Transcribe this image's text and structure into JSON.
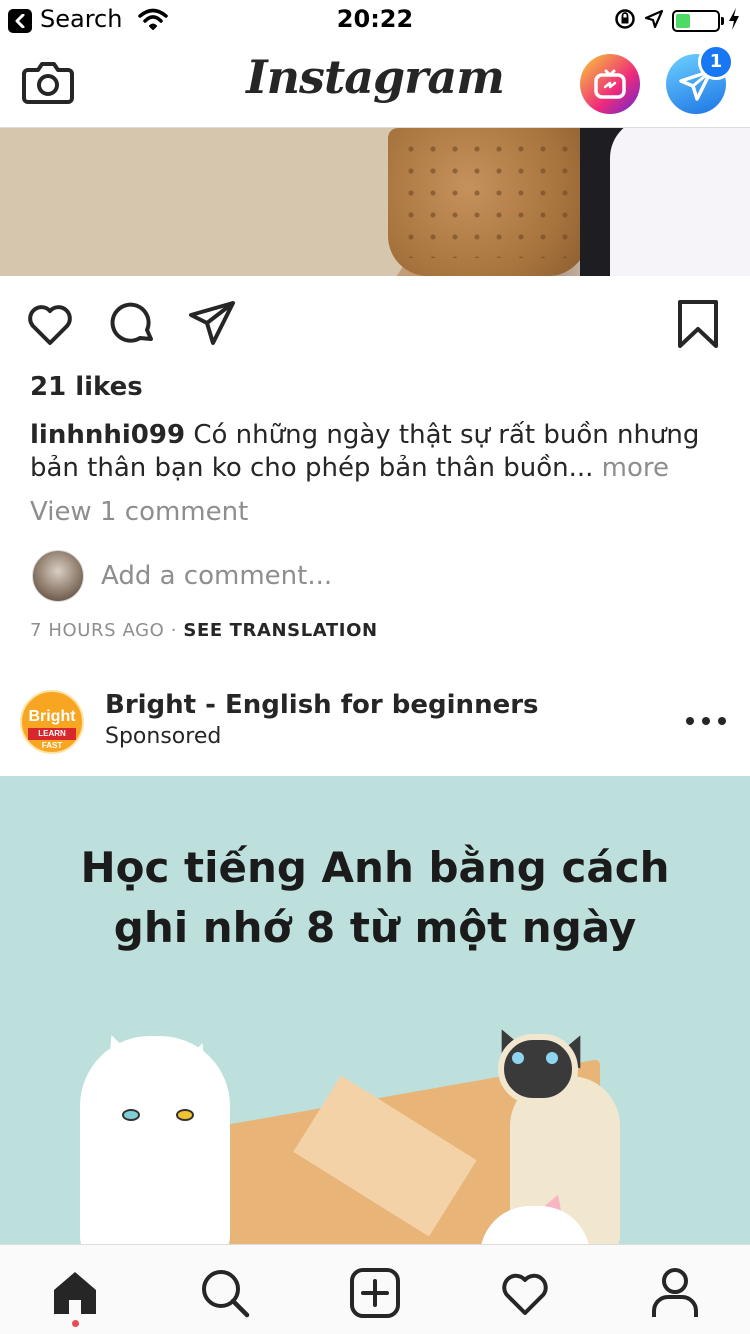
{
  "status_bar": {
    "back_label": "Search",
    "time": "20:22",
    "battery_level": 0.35
  },
  "header": {
    "logo_text": "Instagram",
    "dm_badge_count": "1"
  },
  "post": {
    "likes": "21 likes",
    "username": "linhnhi099",
    "caption_text": " Có những ngày thật sự rất buồn nhưng bản thân bạn ko cho phép bản thân buồn...",
    "more_label": " more",
    "view_comments": "View 1 comment",
    "add_comment_placeholder": "Add a comment...",
    "time_ago": "7 HOURS AGO",
    "separator": " · ",
    "see_translation": "SEE TRANSLATION"
  },
  "sponsored_post": {
    "account_name": "Bright - English for beginners",
    "subtitle": "Sponsored",
    "avatar_line1": "Bright",
    "avatar_line2": "LEARN FAST",
    "ad_title_line1": "Học tiếng Anh bằng cách",
    "ad_title_line2": "ghi nhớ 8 từ một ngày"
  },
  "tabbar": {
    "items": [
      "home-icon",
      "search-icon",
      "new-post-icon",
      "activity-icon",
      "profile-icon"
    ],
    "active": "home-icon"
  },
  "colors": {
    "accent_blue": "#1877f2",
    "notification_red": "#ed4956",
    "ad_background": "#bde0dd",
    "battery_green": "#4cd964"
  }
}
